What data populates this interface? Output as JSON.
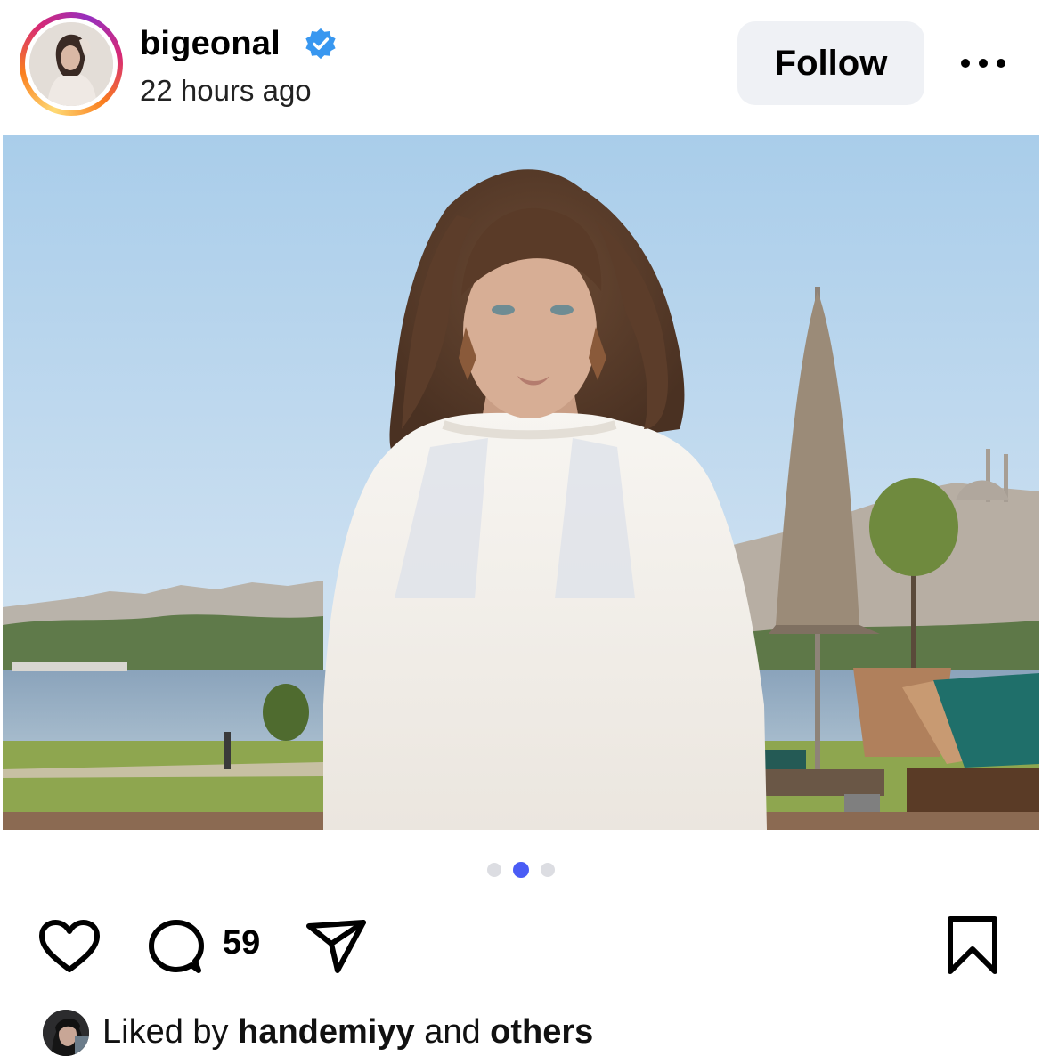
{
  "post": {
    "author": {
      "username": "bigeonal",
      "verified": true,
      "time_ago": "22 hours ago",
      "avatar_icon": "profile-avatar"
    },
    "follow_label": "Follow",
    "more_icon": "more-horizontal-icon",
    "carousel": {
      "total": 3,
      "active_index": 1
    },
    "actions": {
      "like_icon": "heart-icon",
      "comment_icon": "comment-icon",
      "comment_count": "59",
      "share_icon": "send-icon",
      "save_icon": "bookmark-icon"
    },
    "likes": {
      "prefix": "Liked by",
      "user": "handemiyy",
      "conjunction": "and",
      "others": "others"
    }
  },
  "colors": {
    "accent_blue": "#4a5cf5",
    "verified_blue": "#3897f0",
    "follow_bg": "#eff1f5"
  }
}
